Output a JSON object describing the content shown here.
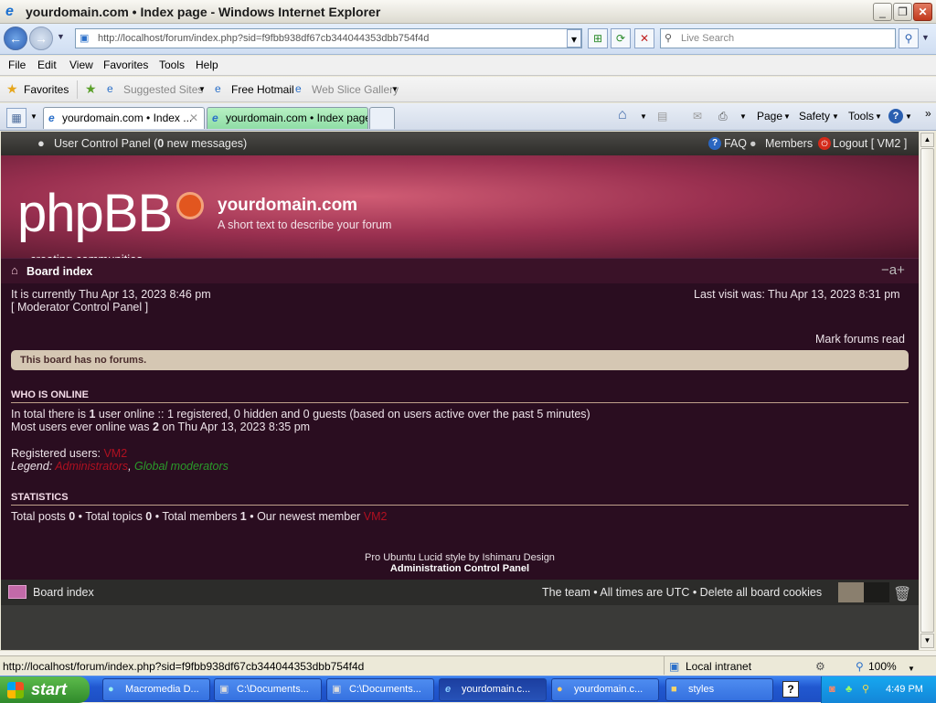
{
  "window": {
    "title": "yourdomain.com • Index page - Windows Internet Explorer"
  },
  "toolbar": {
    "address": "http://localhost/forum/index.php?sid=f9fbb938df67cb344044353dbb754f4d",
    "search_placeholder": "Live Search"
  },
  "menubar": {
    "items": [
      "File",
      "Edit",
      "View",
      "Favorites",
      "Tools",
      "Help"
    ]
  },
  "favorites": {
    "label": "Favorites",
    "items": [
      "Suggested Sites",
      "Free Hotmail",
      "Web Slice Gallery"
    ]
  },
  "tabs": [
    {
      "label": "yourdomain.com • Index ..."
    },
    {
      "label": "yourdomain.com • Index page"
    }
  ],
  "commandbar": {
    "items": [
      "Page",
      "Safety",
      "Tools"
    ]
  },
  "forum": {
    "topnav": {
      "ucp": "User Control Panel (",
      "new_count": "0",
      "new_suffix": " new messages)",
      "faq": "FAQ",
      "members": "Members",
      "logout": "Logout [ VM2 ]"
    },
    "header": {
      "logo": "phpBB",
      "logo_sub": "creating    communities",
      "site_name": "yourdomain.com",
      "site_desc": "A short text to describe your forum"
    },
    "breadcrumb": "Board index",
    "font_resize": "−a+",
    "current_time": "It is currently Thu Apr 13, 2023 8:46 pm",
    "last_visit": "Last visit was: Thu Apr 13, 2023 8:31 pm",
    "mcp_link": "[ Moderator Control Panel ]",
    "mark_read": "Mark forums read",
    "no_forums": "This board has no forums.",
    "who_online": {
      "heading": "WHO IS ONLINE",
      "line1_a": "In total there is ",
      "line1_b": "1",
      "line1_c": " user online :: 1 registered, 0 hidden and 0 guests (based on users active over the past 5 minutes)",
      "line2_a": "Most users ever online was ",
      "line2_b": "2",
      "line2_c": " on Thu Apr 13, 2023 8:35 pm",
      "registered_label": "Registered users: ",
      "registered_user": "VM2",
      "legend_label": "Legend: ",
      "legend_admin": "Administrators",
      "legend_sep": ", ",
      "legend_gmod": "Global moderators"
    },
    "statistics": {
      "heading": "STATISTICS",
      "a": "Total posts ",
      "posts": "0",
      "b": " • Total topics ",
      "topics": "0",
      "c": " • Total members ",
      "members": "1",
      "d": " • Our newest member ",
      "newest": "VM2"
    },
    "credit": "Pro Ubuntu Lucid style by Ishimaru Design",
    "acp": "Administration Control Panel",
    "footer": {
      "breadcrumb": "Board index",
      "links": "The team • All times are UTC • Delete all board cookies"
    }
  },
  "statusbar": {
    "url": "http://localhost/forum/index.php?sid=f9fbb938df67cb344044353dbb754f4d",
    "zone": "Local intranet",
    "zoom": "100%"
  },
  "taskbar": {
    "start": "start",
    "items": [
      "Macromedia D...",
      "C:\\Documents...",
      "C:\\Documents...",
      "yourdomain.c...",
      "yourdomain.c...",
      "styles"
    ],
    "clock": "4:49 PM"
  }
}
